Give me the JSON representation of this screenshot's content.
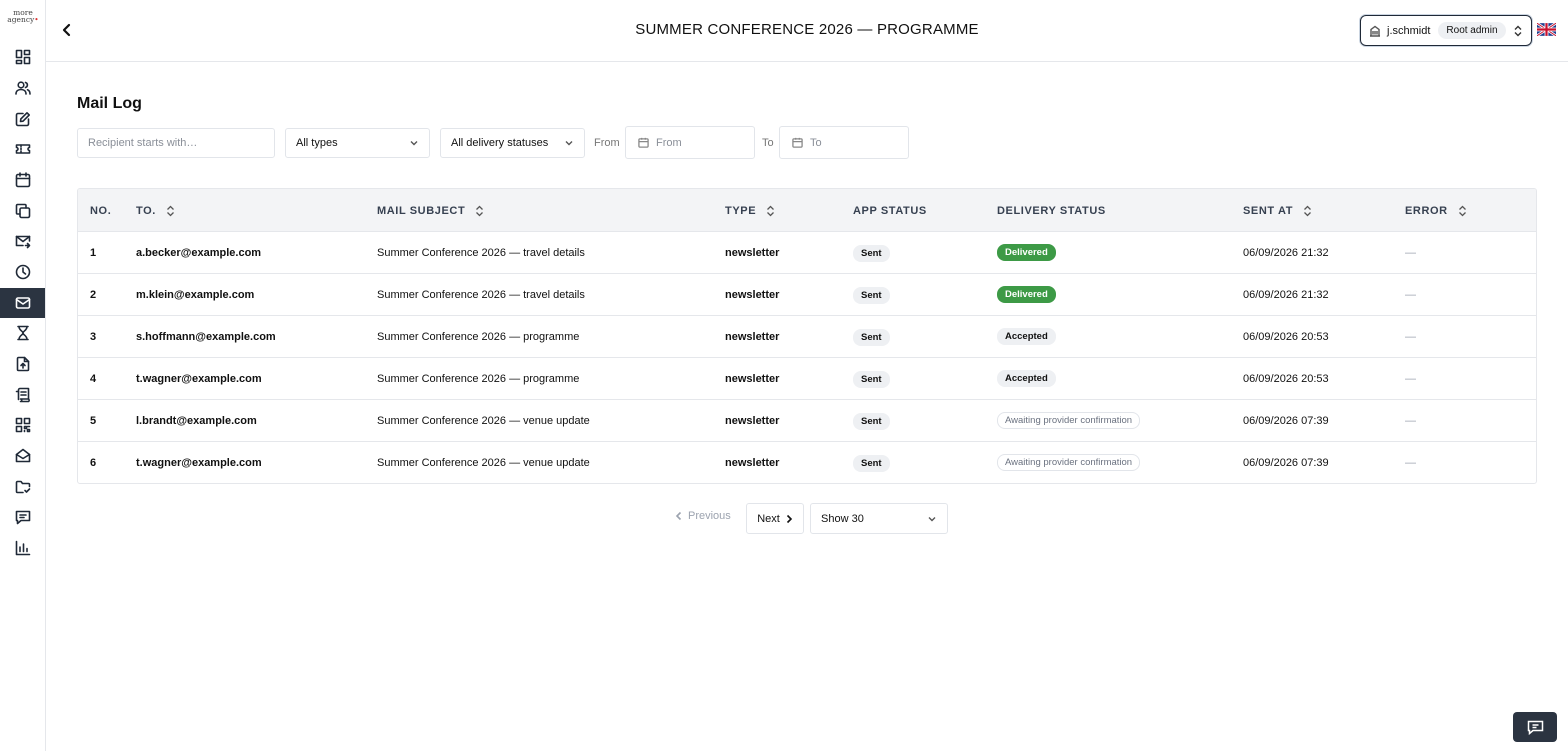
{
  "brand": {
    "logo_line1": "more",
    "logo_line2": "agency"
  },
  "sidebar": {
    "items": [
      {
        "icon": "dashboard-icon",
        "active": false
      },
      {
        "icon": "users-icon",
        "active": false
      },
      {
        "icon": "edit-icon",
        "active": false
      },
      {
        "icon": "ticket-icon",
        "active": false
      },
      {
        "icon": "calendar-icon",
        "active": false
      },
      {
        "icon": "copy-icon",
        "active": false
      },
      {
        "icon": "mail-send-icon",
        "active": false
      },
      {
        "icon": "clock-icon",
        "active": false
      },
      {
        "icon": "mail-icon",
        "active": true
      },
      {
        "icon": "hourglass-icon",
        "active": false
      },
      {
        "icon": "file-upload-icon",
        "active": false
      },
      {
        "icon": "scroll-icon",
        "active": false
      },
      {
        "icon": "qr-code-icon",
        "active": false
      },
      {
        "icon": "mail-open-icon",
        "active": false
      },
      {
        "icon": "folder-check-icon",
        "active": false
      },
      {
        "icon": "message-icon",
        "active": false
      },
      {
        "icon": "bar-chart-icon",
        "active": false
      }
    ]
  },
  "header": {
    "title": "SUMMER CONFERENCE 2026 — PROGRAMME",
    "user": {
      "name": "j.schmidt",
      "role": "Root admin"
    },
    "language_flag": "uk-flag-icon"
  },
  "main": {
    "title": "Mail Log",
    "filters": {
      "recipient_placeholder": "Recipient starts with…",
      "type_value": "All types",
      "delivery_value": "All delivery statuses",
      "from_label": "From",
      "from_placeholder": "From",
      "to_label": "To",
      "to_placeholder": "To"
    },
    "table": {
      "headers": {
        "no": "NO.",
        "to": "TO.",
        "subject": "MAIL SUBJECT",
        "type": "TYPE",
        "app_status": "APP STATUS",
        "delivery_status": "DELIVERY STATUS",
        "sent_at": "SENT AT",
        "error": "ERROR"
      },
      "rows": [
        {
          "no": "1",
          "to": "a.becker@example.com",
          "subject": "Summer Conference 2026 — travel details",
          "type": "newsletter",
          "app_status": "Sent",
          "delivery_status": "Delivered",
          "delivery_kind": "delivered",
          "sent_at": "06/09/2026 21:32",
          "error": "—"
        },
        {
          "no": "2",
          "to": "m.klein@example.com",
          "subject": "Summer Conference 2026 — travel details",
          "type": "newsletter",
          "app_status": "Sent",
          "delivery_status": "Delivered",
          "delivery_kind": "delivered",
          "sent_at": "06/09/2026 21:32",
          "error": "—"
        },
        {
          "no": "3",
          "to": "s.hoffmann@example.com",
          "subject": "Summer Conference 2026 — programme",
          "type": "newsletter",
          "app_status": "Sent",
          "delivery_status": "Accepted",
          "delivery_kind": "accepted",
          "sent_at": "06/09/2026 20:53",
          "error": "—"
        },
        {
          "no": "4",
          "to": "t.wagner@example.com",
          "subject": "Summer Conference 2026 — programme",
          "type": "newsletter",
          "app_status": "Sent",
          "delivery_status": "Accepted",
          "delivery_kind": "accepted",
          "sent_at": "06/09/2026 20:53",
          "error": "—"
        },
        {
          "no": "5",
          "to": "l.brandt@example.com",
          "subject": "Summer Conference 2026 — venue update",
          "type": "newsletter",
          "app_status": "Sent",
          "delivery_status": "Awaiting provider confirmation",
          "delivery_kind": "awaiting",
          "sent_at": "06/09/2026 07:39",
          "error": "—"
        },
        {
          "no": "6",
          "to": "t.wagner@example.com",
          "subject": "Summer Conference 2026 — venue update",
          "type": "newsletter",
          "app_status": "Sent",
          "delivery_status": "Awaiting provider confirmation",
          "delivery_kind": "awaiting",
          "sent_at": "06/09/2026 07:39",
          "error": "—"
        }
      ]
    },
    "pagination": {
      "previous": "Previous",
      "next": "Next",
      "page_size": "Show 30"
    }
  },
  "colors": {
    "sidebar_active": "#2b3441",
    "delivered": "#3d9a46"
  }
}
